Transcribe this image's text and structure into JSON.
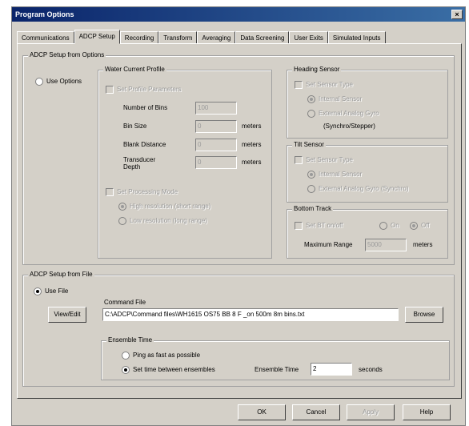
{
  "window": {
    "title": "Program Options",
    "close_glyph": "×"
  },
  "tabs": [
    {
      "label": "Communications"
    },
    {
      "label": "ADCP Setup",
      "active": true
    },
    {
      "label": "Recording"
    },
    {
      "label": "Transform"
    },
    {
      "label": "Averaging"
    },
    {
      "label": "Data Screening"
    },
    {
      "label": "User Exits"
    },
    {
      "label": "Simulated Inputs"
    }
  ],
  "adcp_options": {
    "group_label": "ADCP Setup from Options",
    "use_options_label": "Use Options",
    "water_current": {
      "group_label": "Water Current Profile",
      "set_profile_label": "Set Profile Parameters",
      "number_of_bins_label": "Number of Bins",
      "number_of_bins_value": "100",
      "bin_size_label": "Bin Size",
      "bin_size_value": "0",
      "bin_size_unit": "meters",
      "blank_distance_label": "Blank Distance",
      "blank_distance_value": "0",
      "blank_distance_unit": "meters",
      "transducer_depth_label": "Transducer Depth",
      "transducer_depth_value": "0",
      "transducer_depth_unit": "meters",
      "set_processing_label": "Set Processing Mode",
      "high_res_label": "High resolution (short range)",
      "low_res_label": "Low resolution (long range)"
    },
    "heading_sensor": {
      "group_label": "Heading Sensor",
      "set_label": "Set Sensor Type",
      "internal_label": "Internal Sensor",
      "external_label": "External Analog Gyro",
      "external_note": "(Synchro/Stepper)"
    },
    "tilt_sensor": {
      "group_label": "Tilt Sensor",
      "set_label": "Set Sensor Type",
      "internal_label": "Internal Sensor",
      "external_label": "External Analog Gyro (Synchro)"
    },
    "bottom_track": {
      "group_label": "Bottom Track",
      "set_label": "Set BT on/off",
      "on_label": "On",
      "off_label": "Off",
      "max_range_label": "Maximum Range",
      "max_range_value": "5000",
      "max_range_unit": "meters"
    }
  },
  "adcp_file": {
    "group_label": "ADCP Setup from File",
    "use_file_label": "Use File",
    "command_file_label": "Command File",
    "command_file_value": "C:\\ADCP\\Command files\\WH1615 OS75 BB 8 F _on 500m 8m bins.txt",
    "view_edit_label": "View/Edit",
    "browse_label": "Browse",
    "ensemble_time": {
      "group_label": "Ensemble Time",
      "ping_fast_label": "Ping as fast as possible",
      "set_time_label": "Set time between ensembles",
      "ensemble_time_label": "Ensemble Time",
      "ensemble_time_value": "2",
      "ensemble_time_unit": "seconds"
    }
  },
  "buttons": {
    "ok": "OK",
    "cancel": "Cancel",
    "apply": "Apply",
    "help": "Help"
  }
}
